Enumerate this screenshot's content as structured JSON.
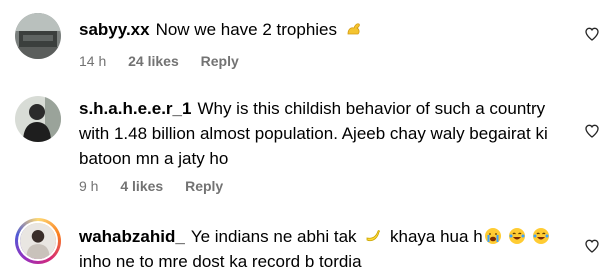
{
  "comments": [
    {
      "username": "sabyy.xx",
      "text": "Now we have 2 trophies",
      "emoji": "flexed-biceps-icon",
      "time": "14 h",
      "likes": "24 likes",
      "reply": "Reply",
      "story_ring": false
    },
    {
      "username": "s.h.a.h.e.e.r_1",
      "text": "Why is this childish behavior of such a country with 1.48 billion almost population. Ajeeb chay waly begairat ki batoon mn a jaty ho",
      "time": "9 h",
      "likes": "4 likes",
      "reply": "Reply",
      "story_ring": false
    },
    {
      "username": "wahabzahid_",
      "text_part1": "Ye indians ne abhi tak",
      "text_part2": "khaya hua h",
      "text_part3": "inho ne to mre dost ka record b tordia",
      "emojis": [
        "banana-icon",
        "loudly-crying-face-icon",
        "face-with-tears-of-joy-icon",
        "face-with-tears-of-joy-icon"
      ],
      "story_ring": true
    }
  ],
  "colors": {
    "meta_text": "#737373",
    "story_ring_gradient": [
      "#feda75",
      "#fa7e1e",
      "#d62976",
      "#962fbf",
      "#4f5bd5"
    ]
  },
  "icons": {
    "like": "heart-outline-icon"
  }
}
